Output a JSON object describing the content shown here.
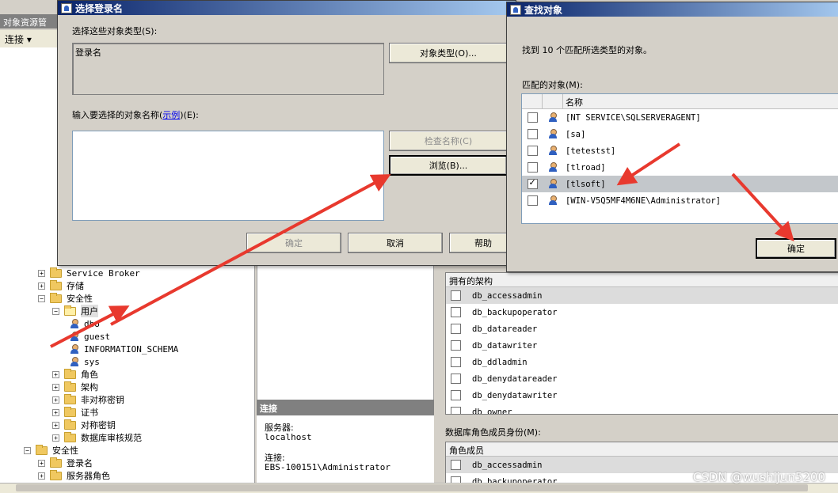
{
  "oe": {
    "header": "对象资源管",
    "connect_label": "连接 ▾",
    "tree": [
      {
        "label": "Service Broker",
        "kind": "folder",
        "indent": 1,
        "expander": "+"
      },
      {
        "label": "存储",
        "kind": "folder",
        "indent": 1,
        "expander": "+"
      },
      {
        "label": "安全性",
        "kind": "folder",
        "indent": 1,
        "expander": "−"
      },
      {
        "label": "用户",
        "kind": "folder-open",
        "indent": 2,
        "expander": "−"
      },
      {
        "label": "dbo",
        "kind": "user",
        "indent": 3
      },
      {
        "label": "guest",
        "kind": "user",
        "indent": 3
      },
      {
        "label": "INFORMATION_SCHEMA",
        "kind": "user",
        "indent": 3
      },
      {
        "label": "sys",
        "kind": "user",
        "indent": 3
      },
      {
        "label": "角色",
        "kind": "folder",
        "indent": 2,
        "expander": "+"
      },
      {
        "label": "架构",
        "kind": "folder",
        "indent": 2,
        "expander": "+"
      },
      {
        "label": "非对称密钥",
        "kind": "folder",
        "indent": 2,
        "expander": "+"
      },
      {
        "label": "证书",
        "kind": "folder",
        "indent": 2,
        "expander": "+"
      },
      {
        "label": "对称密钥",
        "kind": "folder",
        "indent": 2,
        "expander": "+"
      },
      {
        "label": "数据库审核规范",
        "kind": "folder",
        "indent": 2,
        "expander": "+"
      },
      {
        "label": "安全性",
        "kind": "folder",
        "indent": 0,
        "expander": "−"
      },
      {
        "label": "登录名",
        "kind": "folder",
        "indent": 1,
        "expander": "+"
      },
      {
        "label": "服务器角色",
        "kind": "folder",
        "indent": 1,
        "expander": "+"
      }
    ]
  },
  "connection": {
    "title": "连接",
    "server_label": "服务器:",
    "server_value": "localhost",
    "conn_label": "连接:",
    "conn_value": "EBS-100151\\Administrator"
  },
  "schemas": {
    "header": "拥有的架构",
    "items": [
      "db_accessadmin",
      "db_backupoperator",
      "db_datareader",
      "db_datawriter",
      "db_ddladmin",
      "db_denydatareader",
      "db_denydatawriter",
      "db_owner"
    ]
  },
  "roles": {
    "section_label": "数据库角色成员身份(M):",
    "header": "角色成员",
    "items": [
      "db_accessadmin",
      "db_backupoperator"
    ]
  },
  "select_login": {
    "title": "选择登录名",
    "types_label": "选择这些对象类型(S):",
    "types_value": "登录名",
    "object_types_button": "对象类型(O)...",
    "names_label_prefix": "输入要选择的对象名称(",
    "names_label_link": "示例",
    "names_label_suffix": ")(E):",
    "check_names_button": "检查名称(C)",
    "browse_button": "浏览(B)...",
    "ok_button": "确定",
    "cancel_button": "取消",
    "help_button": "帮助"
  },
  "find_objects": {
    "title": "查找对象",
    "found_text": "找到 10 个匹配所选类型的对象。",
    "matches_label": "匹配的对象(M):",
    "name_column": "名称",
    "rows": [
      {
        "name": "[NT SERVICE\\SQLSERVERAGENT]",
        "checked": false
      },
      {
        "name": "[sa]",
        "checked": false
      },
      {
        "name": "[tetestst]",
        "checked": false
      },
      {
        "name": "[tlroad]",
        "checked": false
      },
      {
        "name": "[tlsoft]",
        "checked": true
      },
      {
        "name": "[WIN-V5Q5MF4M6NE\\Administrator]",
        "checked": false
      }
    ],
    "ok_button": "确定"
  },
  "watermark": "CSDN @wushijun5200",
  "colors": {
    "arrow": "#e8392e",
    "title_bar": "#0a246a",
    "selected_row": "#c3c7cb"
  }
}
